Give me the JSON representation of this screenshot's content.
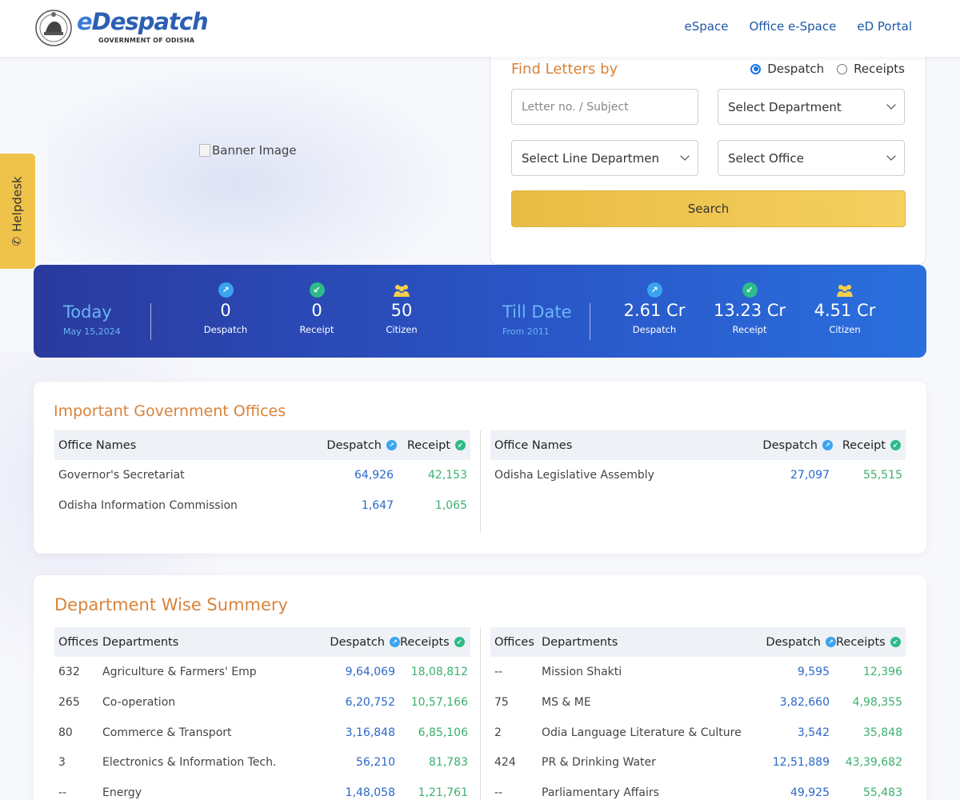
{
  "header": {
    "logo_e": "e",
    "logo_rest": "Despatch",
    "logo_sub": "GOVERNMENT OF ODISHA",
    "nav": [
      "eSpace",
      "Office e-Space",
      "eD Portal"
    ]
  },
  "helpdesk": {
    "label": "Helpdesk"
  },
  "banner": {
    "alt": "Banner Image"
  },
  "search": {
    "title": "Find Letters by",
    "radio_despatch": "Despatch",
    "radio_receipts": "Receipts",
    "selected_radio": "Despatch",
    "letter_placeholder": "Letter no. / Subject",
    "department": "Select Department",
    "line_department": "Select Line Departmen",
    "office": "Select Office",
    "button": "Search"
  },
  "stats": {
    "today_label": "Today",
    "today_date": "May 15,2024",
    "today": [
      {
        "value": "0",
        "label": "Despatch"
      },
      {
        "value": "0",
        "label": "Receipt"
      },
      {
        "value": "50",
        "label": "Citizen"
      }
    ],
    "till_label": "Till Date",
    "till_from": "From 2011",
    "till": [
      {
        "value": "2.61 Cr",
        "label": "Despatch"
      },
      {
        "value": "13.23 Cr",
        "label": "Receipt"
      },
      {
        "value": "4.51 Cr",
        "label": "Citizen"
      }
    ]
  },
  "offices": {
    "title": "Important Government Offices",
    "headers": [
      "Office Names",
      "Despatch",
      "Receipt"
    ],
    "left": [
      {
        "name": "Governor's Secretariat",
        "despatch": "64,926",
        "receipt": "42,153"
      },
      {
        "name": "Odisha Information Commission",
        "despatch": "1,647",
        "receipt": "1,065"
      }
    ],
    "right": [
      {
        "name": "Odisha Legislative Assembly",
        "despatch": "27,097",
        "receipt": "55,515"
      }
    ]
  },
  "departments": {
    "title": "Department Wise Summery",
    "headers": [
      "Offices",
      "Departments",
      "Despatch",
      "Receipts"
    ],
    "left": [
      {
        "offices": "632",
        "name": "Agriculture & Farmers' Emp",
        "despatch": "9,64,069",
        "receipts": "18,08,812"
      },
      {
        "offices": "265",
        "name": "Co-operation",
        "despatch": "6,20,752",
        "receipts": "10,57,166"
      },
      {
        "offices": "80",
        "name": "Commerce & Transport",
        "despatch": "3,16,848",
        "receipts": "6,85,106"
      },
      {
        "offices": "3",
        "name": "Electronics & Information Tech.",
        "despatch": "56,210",
        "receipts": "81,783"
      },
      {
        "offices": "--",
        "name": "Energy",
        "despatch": "1,48,058",
        "receipts": "1,21,761"
      }
    ],
    "right": [
      {
        "offices": "--",
        "name": "Mission Shakti",
        "despatch": "9,595",
        "receipts": "12,396"
      },
      {
        "offices": "75",
        "name": "MS & ME",
        "despatch": "3,82,660",
        "receipts": "4,98,355"
      },
      {
        "offices": "2",
        "name": "Odia Language Literature & Culture",
        "despatch": "3,542",
        "receipts": "35,848"
      },
      {
        "offices": "424",
        "name": "PR & Drinking Water",
        "despatch": "12,51,889",
        "receipts": "43,39,682"
      },
      {
        "offices": "--",
        "name": "Parliamentary Affairs",
        "despatch": "49,925",
        "receipts": "55,483"
      }
    ]
  },
  "colors": {
    "accent_orange": "#d9833a",
    "brand_blue": "#2058a8",
    "despatch_blue": "#2c67c9",
    "receipt_green": "#3bb06e",
    "search_yellow": "#efc34a"
  }
}
